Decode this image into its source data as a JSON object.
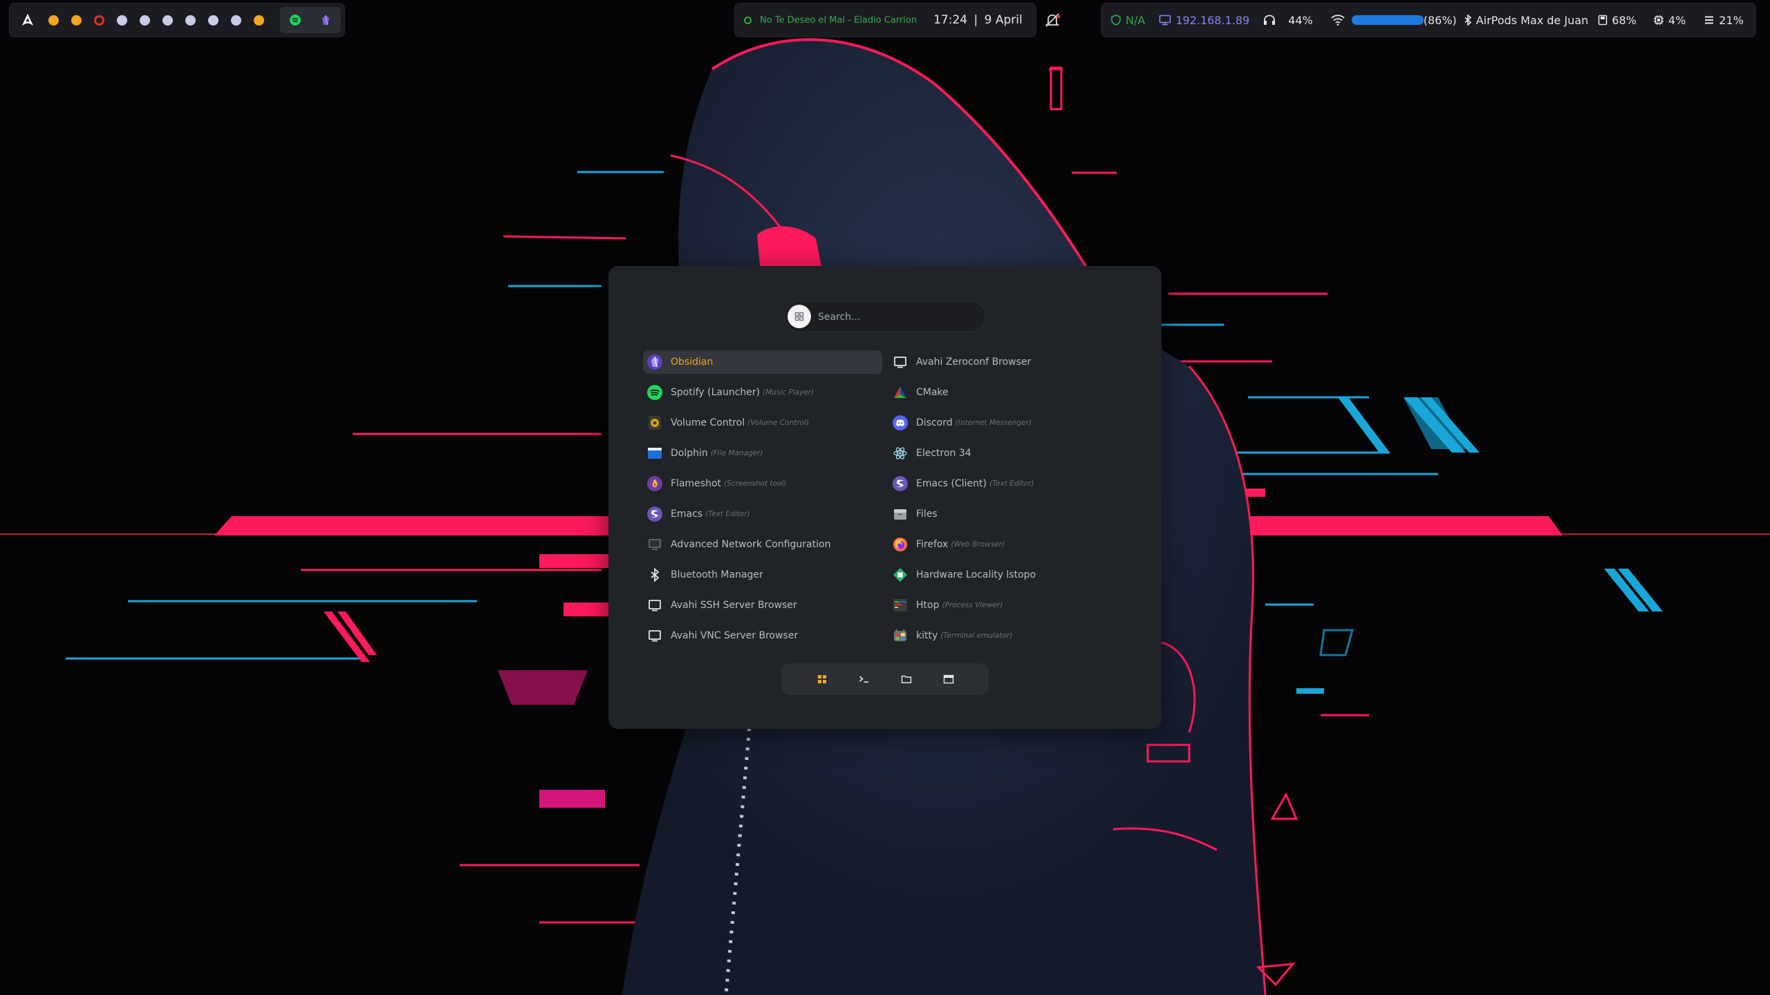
{
  "colors": {
    "accent": "#f5a623",
    "neon_pink": "#ff1a5c",
    "neon_cyan": "#19a7d9",
    "media_green": "#38a84a",
    "ip_purple": "#8b83f5",
    "power_red": "#e03131",
    "launcher_bg": "#202327"
  },
  "topbar": {
    "left": {
      "logo_icon": "arch-linux-logo",
      "workspaces": [
        {
          "state": "occupied"
        },
        {
          "state": "occupied"
        },
        {
          "state": "urgent"
        },
        {
          "state": "empty"
        },
        {
          "state": "empty"
        },
        {
          "state": "empty"
        },
        {
          "state": "empty"
        },
        {
          "state": "empty"
        },
        {
          "state": "empty"
        },
        {
          "state": "occupied"
        }
      ],
      "tray_icons": [
        "spotify-icon",
        "obsidian-icon"
      ]
    },
    "center": {
      "media": "No Te Deseo el Mal - Eladio Carrion",
      "time": "17:24",
      "separator": "|",
      "date": "9 April",
      "notification_icon": "bell-muted-icon"
    },
    "right": {
      "vpn": "N/A",
      "ip": "192.168.1.89",
      "headphone_volume": "44%",
      "wifi_strength": "(86%)",
      "bluetooth_device": "AirPods Max de Juan",
      "disk": "68%",
      "cpu": "4%",
      "memory": "21%",
      "power_icon": "power-icon"
    }
  },
  "launcher": {
    "search": {
      "placeholder": "Search...",
      "value": ""
    },
    "apps_left": [
      {
        "name": "Obsidian",
        "category": "",
        "icon": "obsidian-icon",
        "selected": true
      },
      {
        "name": "Spotify (Launcher)",
        "category": "(Music Player)",
        "icon": "spotify-icon"
      },
      {
        "name": "Volume Control",
        "category": "(Volume Control)",
        "icon": "volume-control-icon"
      },
      {
        "name": "Dolphin",
        "category": "(File Manager)",
        "icon": "dolphin-icon"
      },
      {
        "name": "Flameshot",
        "category": "(Screenshot tool)",
        "icon": "flameshot-icon"
      },
      {
        "name": "Emacs",
        "category": "(Text Editor)",
        "icon": "emacs-icon"
      },
      {
        "name": "Advanced Network Configuration",
        "category": "",
        "icon": "network-config-icon"
      },
      {
        "name": "Bluetooth Manager",
        "category": "",
        "icon": "bluetooth-icon"
      },
      {
        "name": "Avahi SSH Server Browser",
        "category": "",
        "icon": "monitor-icon"
      },
      {
        "name": "Avahi VNC Server Browser",
        "category": "",
        "icon": "monitor-icon"
      }
    ],
    "apps_right": [
      {
        "name": "Avahi Zeroconf Browser",
        "category": "",
        "icon": "monitor-icon"
      },
      {
        "name": "CMake",
        "category": "",
        "icon": "cmake-icon"
      },
      {
        "name": "Discord",
        "category": "(Internet Messenger)",
        "icon": "discord-icon"
      },
      {
        "name": "Electron 34",
        "category": "",
        "icon": "electron-icon"
      },
      {
        "name": "Emacs (Client)",
        "category": "(Text Editor)",
        "icon": "emacs-icon"
      },
      {
        "name": "Files",
        "category": "",
        "icon": "files-icon"
      },
      {
        "name": "Firefox",
        "category": "(Web Browser)",
        "icon": "firefox-icon"
      },
      {
        "name": "Hardware Locality lstopo",
        "category": "",
        "icon": "hwloc-icon"
      },
      {
        "name": "Htop",
        "category": "(Process Viewer)",
        "icon": "htop-icon"
      },
      {
        "name": "kitty",
        "category": "(Terminal emulator)",
        "icon": "kitty-icon"
      }
    ],
    "modes": [
      {
        "id": "apps",
        "icon": "grid-icon",
        "active": true
      },
      {
        "id": "run",
        "icon": "terminal-icon",
        "active": false
      },
      {
        "id": "files",
        "icon": "folder-icon",
        "active": false
      },
      {
        "id": "windows",
        "icon": "window-icon",
        "active": false
      }
    ]
  }
}
